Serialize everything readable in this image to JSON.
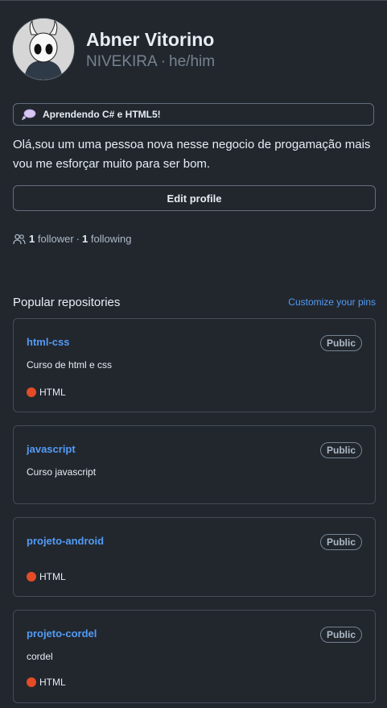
{
  "profile": {
    "name": "Abner Vitorino",
    "username": "NIVEKIRA",
    "separator": "·",
    "pronouns": "he/him",
    "avatar_icon": "hollow-knight-avatar",
    "status": {
      "icon": "thought-balloon-icon",
      "text": "Aprendendo C# e HTML5!"
    },
    "bio": "Olá,sou um uma pessoa nova nesse negocio de progamação mais vou me esforçar muito para ser bom.",
    "edit_label": "Edit profile",
    "followers_count": "1",
    "followers_label": "follower",
    "follow_sep": "·",
    "following_count": "1",
    "following_label": "following"
  },
  "popular": {
    "title": "Popular repositories",
    "customize_label": "Customize your pins",
    "repos": [
      {
        "name": "html-css",
        "visibility": "Public",
        "description": "Curso de html e css",
        "language": "HTML"
      },
      {
        "name": "javascript",
        "visibility": "Public",
        "description": "Curso javascript",
        "language": ""
      },
      {
        "name": "projeto-android",
        "visibility": "Public",
        "description": "",
        "language": "HTML"
      },
      {
        "name": "projeto-cordel",
        "visibility": "Public",
        "description": "cordel",
        "language": "HTML"
      }
    ]
  },
  "colors": {
    "background": "#22272e",
    "link": "#539bf5",
    "html_language": "#e34c26",
    "border": "#444c56"
  }
}
